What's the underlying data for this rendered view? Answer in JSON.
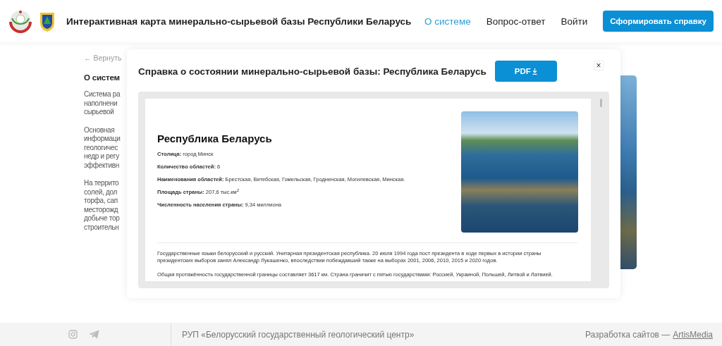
{
  "header": {
    "title": "Интерактивная карта минерально-сырьевой базы Республики Беларусь",
    "nav": [
      {
        "label": "О системе",
        "selected": true
      },
      {
        "label": "Вопрос-ответ",
        "selected": false
      },
      {
        "label": "Войти",
        "selected": false
      }
    ],
    "cta": "Сформировать справку"
  },
  "background": {
    "back_link": "← Вернуть",
    "heading": "О систем",
    "paragraphs": [
      [
        "Система ра",
        "наполнени",
        "сырьевой"
      ],
      [
        "Основная",
        "информаци",
        "геологичес",
        "недр и регу",
        "эффективн"
      ],
      [
        "На террито",
        "солей, дол",
        "торфа, сап",
        "месторожд",
        "добыче тор",
        "строительн"
      ]
    ]
  },
  "modal": {
    "title": "Справка о состоянии минерально-сырьевой базы: Республика Беларусь",
    "pdf_button": "PDF",
    "close": "×",
    "document": {
      "heading": "Республика Беларусь",
      "facts": [
        "**Столица:** город Минск",
        "**Количество областей:** 6",
        "**Наименования областей:** Брестская, Витебская, Гомельская, Гродненская, Могилевская, Минская.",
        "**Площадь страны:** 207,6 тыс.км$^{2}$",
        "**Численность населения страны:** 9,34 миллиона"
      ],
      "paragraphs": [
        "Государственные языки белорусский и русский. Унитарная президентская республика. 20 июля 1994 года пост президента в ходе первых в истории страны президентских выборов занял Александр Лукашенко, впоследствии побеждавший также на выборах 2001, 2006, 2010, 2015 и 2020 годов.",
        "Общая протяжённость государственной границы составляет 3617 км. Страна граничит с пятью государствами: Россией, Украиной, Польшей, Литвой и Латвией."
      ]
    }
  },
  "footer": {
    "org": "РУП «Белорусский государственный геологический центр»",
    "credit": "Разработка сайтов —",
    "credit_link": "ArtisMedia"
  }
}
